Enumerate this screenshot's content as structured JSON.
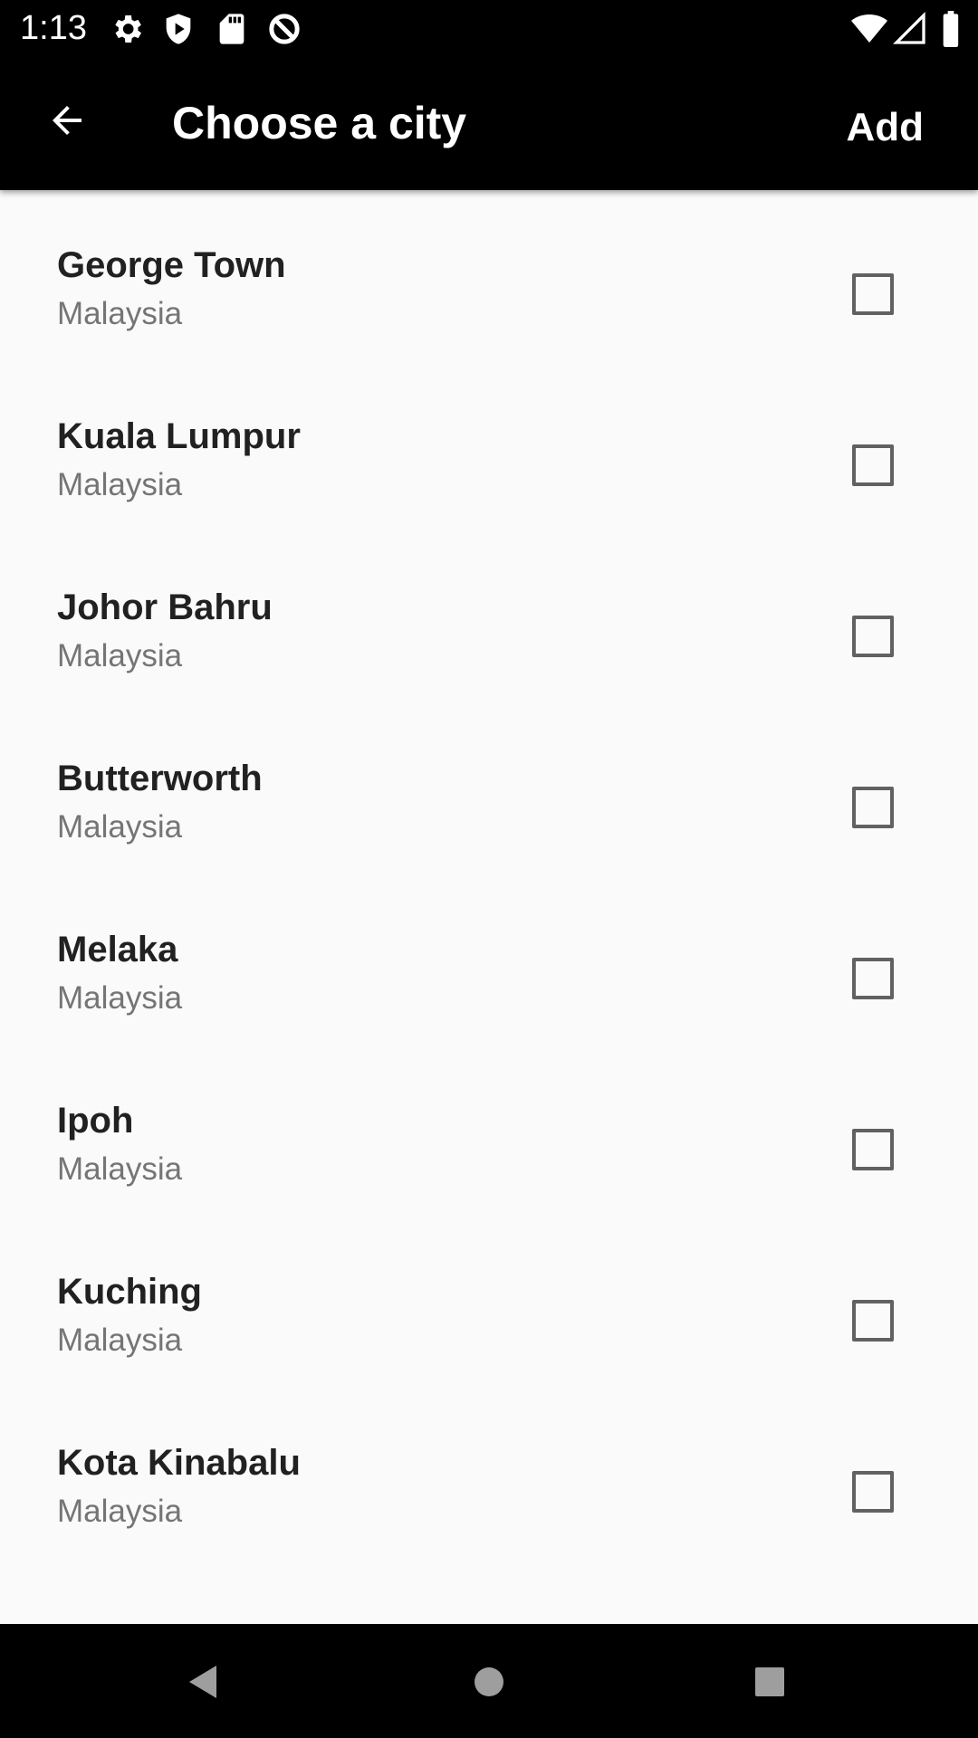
{
  "status_bar": {
    "time": "1:13",
    "icons": [
      "settings-gear-icon",
      "shield-play-icon",
      "sd-card-icon",
      "no-sim-circle-icon",
      "wifi-icon",
      "cell-signal-icon",
      "battery-icon"
    ]
  },
  "app_bar": {
    "back_icon": "arrow-back-icon",
    "title": "Choose a city",
    "action_label": "Add"
  },
  "cities": [
    {
      "name": "George Town",
      "country": "Malaysia",
      "checked": false
    },
    {
      "name": "Kuala Lumpur",
      "country": "Malaysia",
      "checked": false
    },
    {
      "name": "Johor Bahru",
      "country": "Malaysia",
      "checked": false
    },
    {
      "name": "Butterworth",
      "country": "Malaysia",
      "checked": false
    },
    {
      "name": "Melaka",
      "country": "Malaysia",
      "checked": false
    },
    {
      "name": "Ipoh",
      "country": "Malaysia",
      "checked": false
    },
    {
      "name": "Kuching",
      "country": "Malaysia",
      "checked": false
    },
    {
      "name": "Kota Kinabalu",
      "country": "Malaysia",
      "checked": false
    }
  ],
  "nav_bar": {
    "icons": [
      "back-triangle-icon",
      "home-circle-icon",
      "recents-square-icon"
    ]
  },
  "colors": {
    "bar_background": "#000000",
    "list_background": "#fafafa",
    "primary_text": "#212121",
    "secondary_text": "#757575",
    "checkbox_border": "#616161"
  }
}
